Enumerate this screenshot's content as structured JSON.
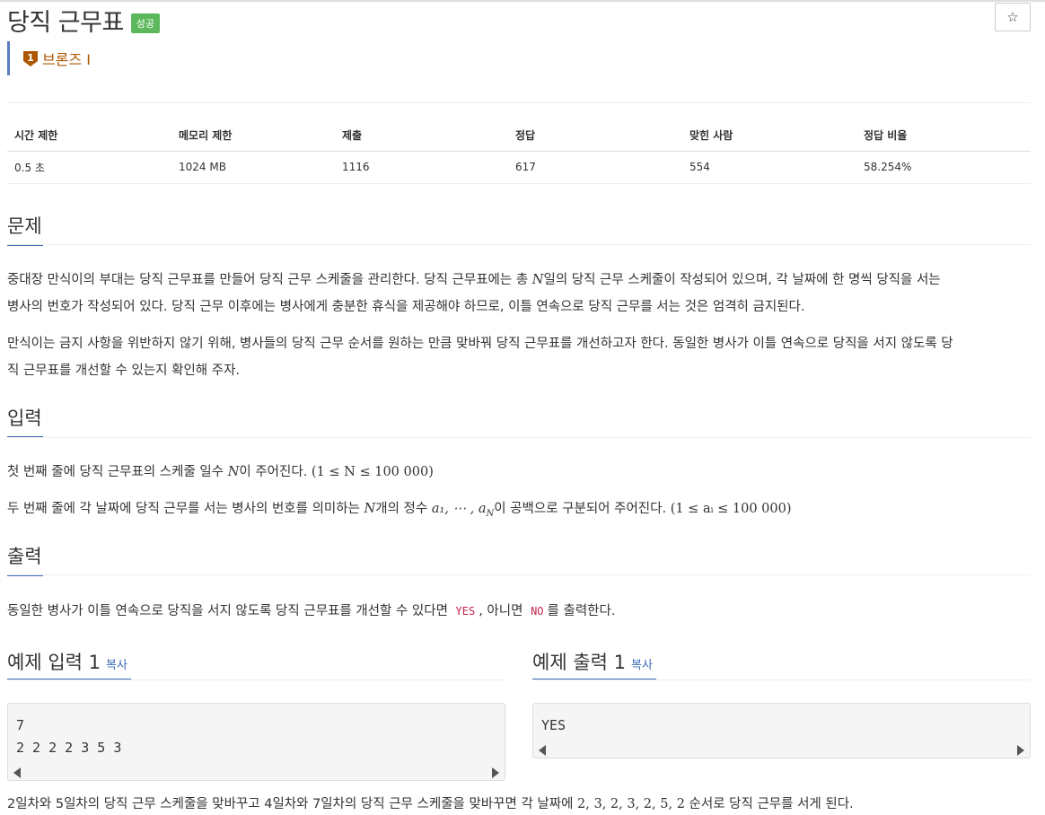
{
  "problem": {
    "title": "당직 근무표",
    "status_badge": "성공",
    "star_icon": "☆",
    "tier_icon": "bronze-tier-1-icon",
    "tier_icon_number": "1",
    "tier_label": "브론즈 I"
  },
  "info_table": {
    "headers": [
      "시간 제한",
      "메모리 제한",
      "제출",
      "정답",
      "맞힌 사람",
      "정답 비율"
    ],
    "values": [
      "0.5 초",
      "1024 MB",
      "1116",
      "617",
      "554",
      "58.254%"
    ]
  },
  "sections": {
    "problem_heading": "문제",
    "p1_a": "중대장 만식이의 부대는 당직 근무표를 만들어 당직 근무 스케줄을 관리한다. 당직 근무표에는 총 ",
    "p1_b": "일의 당직 근무 스케줄이 작성되어 있으며, 각 날짜에 한 명씩 당직을 서는",
    "p1_c": "병사의 번호가 작성되어 있다. 당직 근무 이후에는 병사에게 충분한 휴식을 제공해야 하므로, 이틀 연속으로 당직 근무를 서는 것은 엄격히 금지된다.",
    "p2_a": "만식이는 금지 사항을 위반하지 않기 위해, 병사들의 당직 근무 순서를 원하는 만큼 맞바꿔 당직 근무표를 개선하고자 한다. 동일한 병사가 이틀 연속으로 당직을 서지 않도록 당",
    "p2_b": "직 근무표를 개선할 수 있는지 확인해 주자.",
    "input_heading": "입력",
    "in1_a": "첫 번째 줄에 당직 근무표의 스케줄 일수 ",
    "in1_b": "이 주어진다. ",
    "in1_math": "(1 ≤ N ≤ 100 000)",
    "in2_a": "두 번째 줄에 각 날짜에 당직 근무를 서는 병사의 번호를 의미하는 ",
    "in2_b": "개의 정수 ",
    "in2_seq": "a₁, ⋯ , a",
    "in2_c": "이 공백으로 구분되어 주어진다. ",
    "in2_math": "(1 ≤ aᵢ ≤ 100 000)",
    "var_n": "N",
    "var_sub_n": "N",
    "output_heading": "출력",
    "out_a": "동일한 병사가 이틀 연속으로 당직을 서지 않도록 당직 근무표를 개선할 수 있다면",
    "out_yes": "YES",
    "out_b": ", 아니면",
    "out_no": "NO",
    "out_c": "를 출력한다.",
    "note_a": "2일차와 5일차의 당직 근무 스케줄을 맞바꾸고 4일차와 7일차의 당직 근무 스케줄을 맞바꾸면 각 날짜에 ",
    "note_seq": "2, 3, 2, 3, 2, 5, 2",
    "note_b": " 순서로 당직 근무를 서게 된다."
  },
  "examples": {
    "input_heading": "예제 입력 1",
    "output_heading": "예제 출력 1",
    "copy_label": "복사",
    "input_text": "7\n2 2 2 2 3 5 3",
    "output_text": "YES"
  }
}
